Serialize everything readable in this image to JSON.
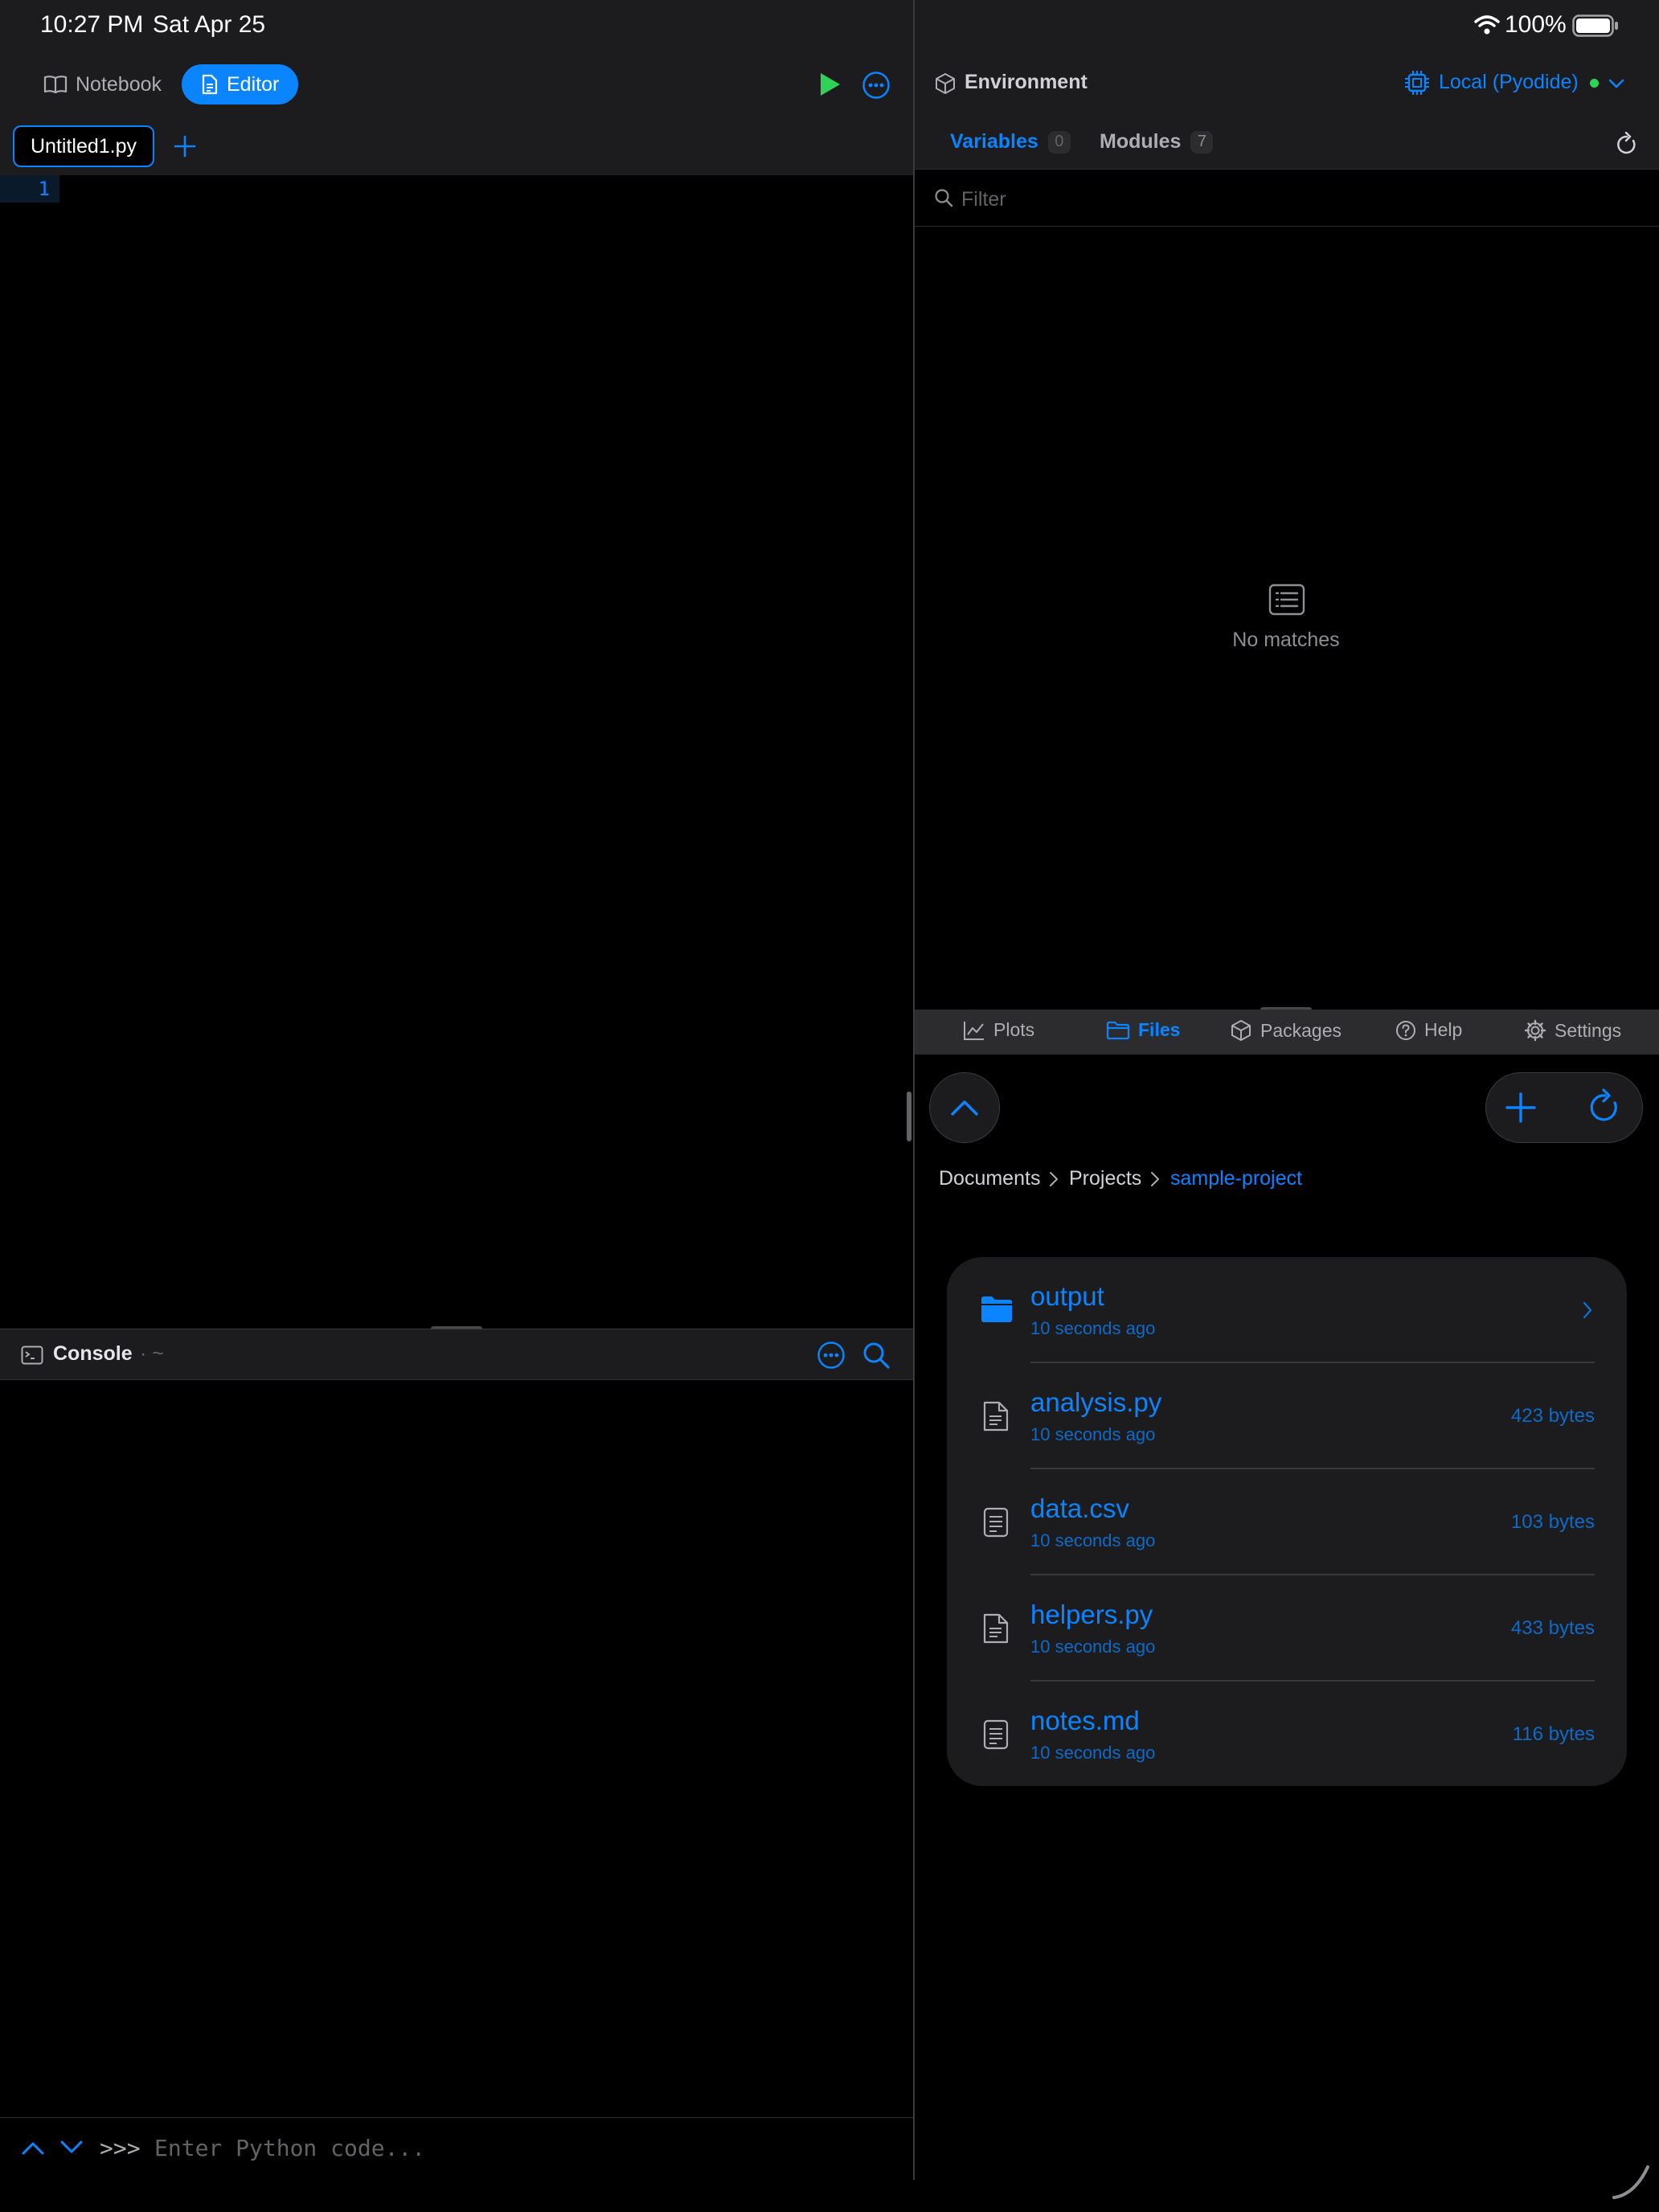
{
  "status_bar": {
    "time": "10:27 PM",
    "date": "Sat Apr 25",
    "battery": "100%",
    "icons": [
      "wifi-icon",
      "battery-icon"
    ]
  },
  "left_pane": {
    "segments": [
      {
        "label": "Notebook",
        "icon": "book-icon",
        "selected": false
      },
      {
        "label": "Editor",
        "icon": "document-icon",
        "selected": true
      }
    ],
    "toolbar_icons": [
      "run-icon",
      "more-icon"
    ],
    "file_tabs": [
      {
        "label": "Untitled1.py",
        "selected": true
      }
    ],
    "add_tab_icon": "plus-icon",
    "editor": {
      "line_numbers": [
        "1"
      ]
    },
    "console": {
      "title": "Console",
      "path": "· ~",
      "prompt": ">>>",
      "placeholder": "Enter Python code...",
      "icons": [
        "terminal-icon",
        "more-icon",
        "search-icon",
        "history-up-icon",
        "history-down-icon"
      ]
    }
  },
  "right_pane": {
    "environment": {
      "title": "Environment",
      "runtime": "Local (Pyodide)",
      "runtime_status_color": "#30d158",
      "tabs": [
        {
          "label": "Variables",
          "count": "0",
          "selected": true
        },
        {
          "label": "Modules",
          "count": "7",
          "selected": false
        }
      ],
      "filter_placeholder": "Filter",
      "empty_text": "No matches"
    },
    "bottom_tabs": [
      {
        "label": "Plots",
        "icon": "chart-icon",
        "selected": false
      },
      {
        "label": "Files",
        "icon": "folder-icon",
        "selected": true
      },
      {
        "label": "Packages",
        "icon": "package-icon",
        "selected": false
      },
      {
        "label": "Help",
        "icon": "help-icon",
        "selected": false
      },
      {
        "label": "Settings",
        "icon": "gear-icon",
        "selected": false
      }
    ],
    "files": {
      "breadcrumb": [
        "Documents",
        "Projects",
        "sample-project"
      ],
      "items": [
        {
          "name": "output",
          "time": "10 seconds ago",
          "size": "",
          "type": "folder"
        },
        {
          "name": "analysis.py",
          "time": "10 seconds ago",
          "size": "423 bytes",
          "type": "file"
        },
        {
          "name": "data.csv",
          "time": "10 seconds ago",
          "size": "103 bytes",
          "type": "file"
        },
        {
          "name": "helpers.py",
          "time": "10 seconds ago",
          "size": "433 bytes",
          "type": "file"
        },
        {
          "name": "notes.md",
          "time": "10 seconds ago",
          "size": "116 bytes",
          "type": "file"
        }
      ]
    }
  },
  "colors": {
    "accent": "#0a84ff",
    "run": "#30d158",
    "background": "#000000",
    "panel": "#1c1c1e"
  }
}
